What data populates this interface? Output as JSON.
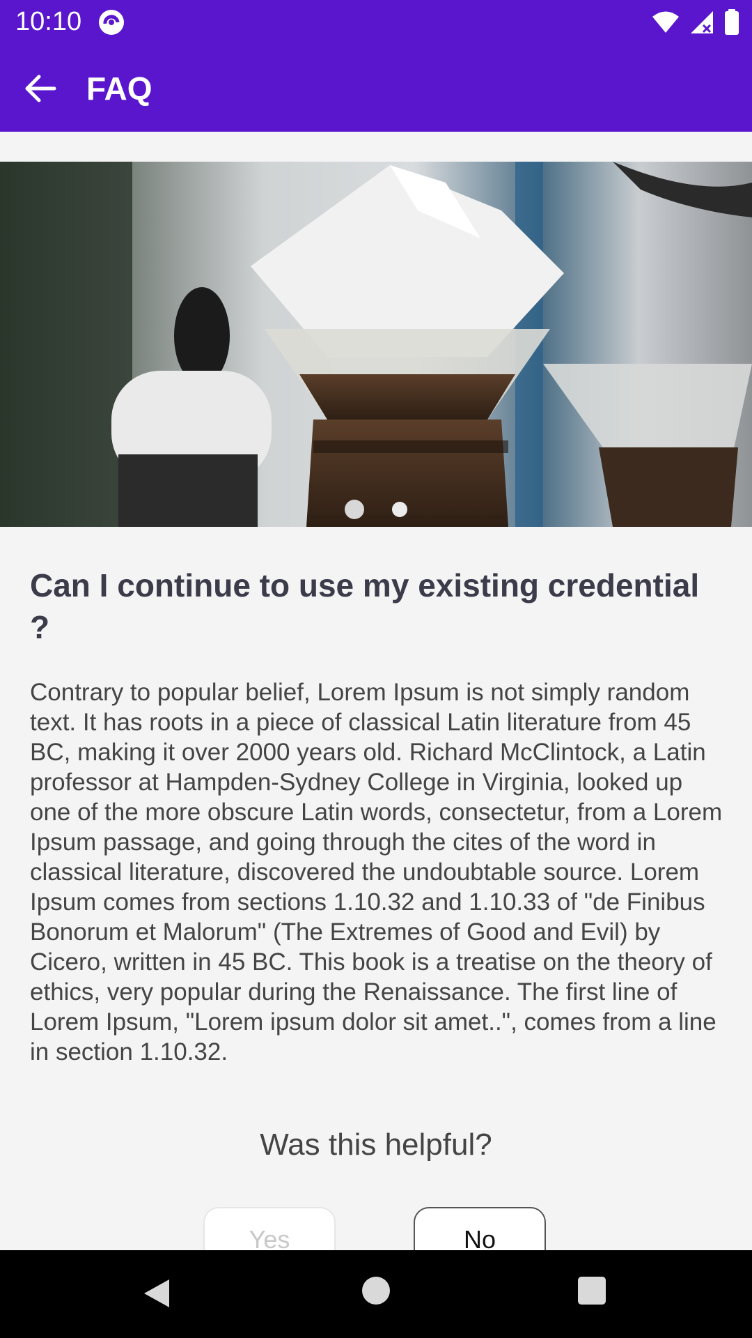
{
  "status_bar": {
    "time": "10:10",
    "icons": [
      "app-notification-icon",
      "wifi-icon",
      "cellular-icon",
      "battery-icon"
    ]
  },
  "app_bar": {
    "title": "FAQ",
    "back_icon": "arrow-left-icon",
    "color": "#5a16cc"
  },
  "carousel": {
    "image_desc": "coffee-pour-over-photo",
    "pages": 2,
    "active_index": 0
  },
  "faq": {
    "question": "Can I continue to use my existing credential ?",
    "answer": "Contrary to popular belief, Lorem Ipsum is not simply random text. It has roots in a piece of classical Latin literature from 45 BC, making it over 2000 years old. Richard McClintock, a Latin professor at Hampden-Sydney College in Virginia, looked up one of the more obscure Latin words, consectetur, from a Lorem Ipsum passage, and going through the cites of the word in classical literature, discovered the undoubtable source. Lorem Ipsum comes from sections 1.10.32 and 1.10.33 of \"de Finibus Bonorum et Malorum\" (The Extremes of Good and Evil) by Cicero, written in 45 BC. This book is a treatise on the theory of ethics, very popular during the Renaissance. The first line of Lorem Ipsum, \"Lorem ipsum dolor sit amet..\", comes from a line in section 1.10.32."
  },
  "feedback": {
    "prompt": "Was this helpful?",
    "yes_label": "Yes",
    "no_label": "No"
  },
  "nav_bar": {
    "icons": [
      "nav-back-icon",
      "nav-home-icon",
      "nav-recents-icon"
    ]
  }
}
